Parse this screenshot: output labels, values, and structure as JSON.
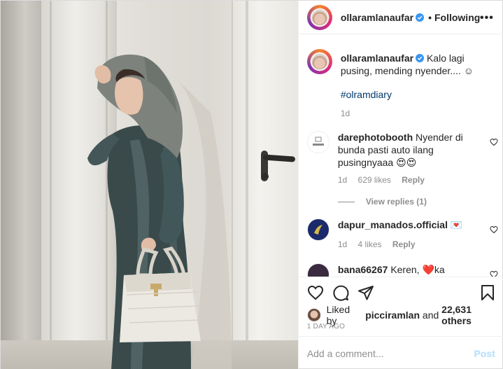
{
  "header": {
    "username": "ollaramlanaufar",
    "separator": "•",
    "follow_status": "Following",
    "more_label": "•••"
  },
  "caption": {
    "username": "ollaramlanaufar",
    "text": "Kalo lagi pusing, mending nyender.... ☺",
    "hashtag": "#olramdiary",
    "time": "1d"
  },
  "comments": [
    {
      "username": "darephotobooth",
      "text": "Nyender di bunda pasti auto ilang pusingnyaaa 😍😍",
      "time": "1d",
      "likes": "629 likes",
      "reply": "Reply",
      "view_replies": "View replies (1)"
    },
    {
      "username": "dapur_manados.official",
      "text": "💌",
      "time": "1d",
      "likes": "4 likes",
      "reply": "Reply"
    },
    {
      "username": "bana66267",
      "text": "Keren, ❤️ka"
    }
  ],
  "actions": {
    "liked_by_prefix": "Liked by",
    "liked_by_user": "picciramlan",
    "liked_by_suffix": "and",
    "liked_by_count": "22,631 others",
    "time_ago": "1 DAY AGO"
  },
  "add_comment": {
    "placeholder": "Add a comment...",
    "post_label": "Post"
  },
  "icons": {
    "like": "heart-icon",
    "comment": "comment-icon",
    "share": "share-icon",
    "save": "bookmark-icon",
    "verified": "verified-badge-icon",
    "more": "more-options-icon"
  },
  "colors": {
    "link": "#00376b",
    "muted": "#8e8e8e",
    "post_button": "#b2dffc",
    "verified": "#3897f0"
  }
}
